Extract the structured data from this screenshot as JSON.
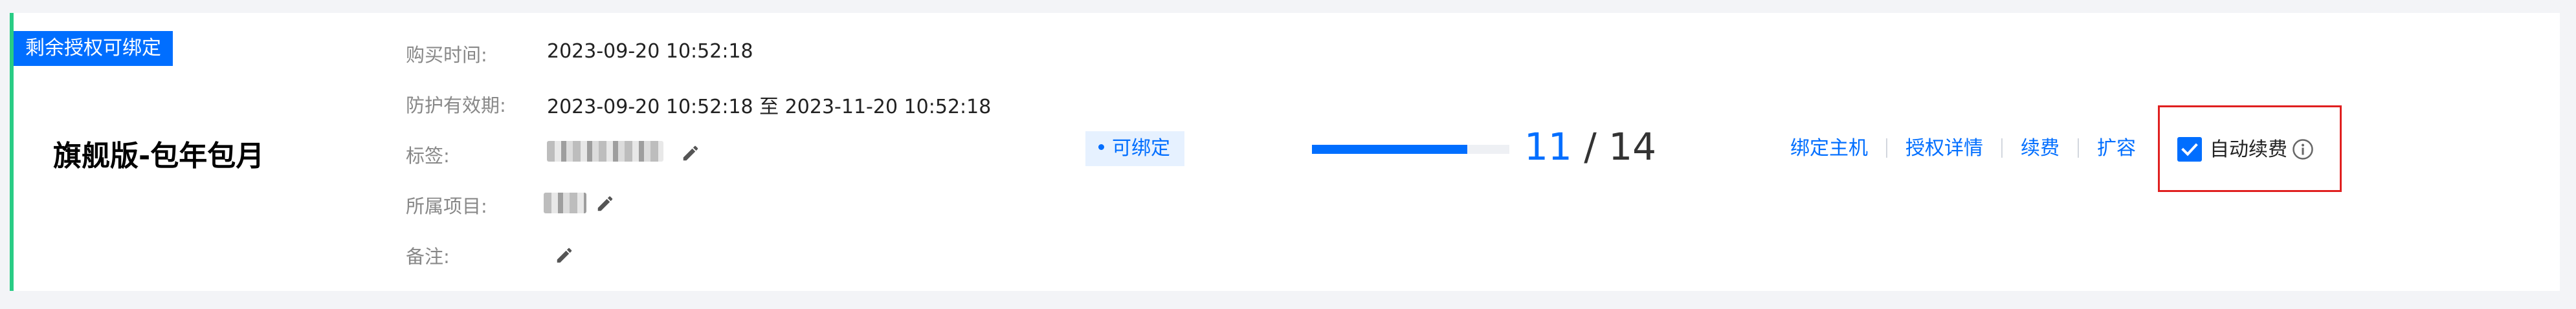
{
  "card": {
    "ribbon_label": "剩余授权可绑定",
    "package_name": "旗舰版-包年包月",
    "fields": {
      "purchase_time_label": "购买时间:",
      "purchase_time_value": "2023-09-20 10:52:18",
      "validity_label": "防护有效期:",
      "validity_value": "2023-09-20 10:52:18 至 2023-11-20 10:52:18",
      "tag_label": "标签:",
      "project_label": "所属项目:",
      "remark_label": "备注:"
    },
    "status_badge": "可绑定",
    "usage": {
      "used": "11",
      "separator": "/",
      "total": "14",
      "used_fraction": 0.786
    },
    "actions": {
      "bind_host": "绑定主机",
      "license_details": "授权详情",
      "renew": "续费",
      "expand": "扩容"
    },
    "auto_renew": {
      "label": "自动续费",
      "checked": true
    },
    "icons": [
      "edit-icon",
      "check-icon",
      "info-icon"
    ],
    "colors": {
      "accent": "#006eff",
      "status_bar": "#29cc85",
      "highlight_box": "#e02020"
    }
  }
}
